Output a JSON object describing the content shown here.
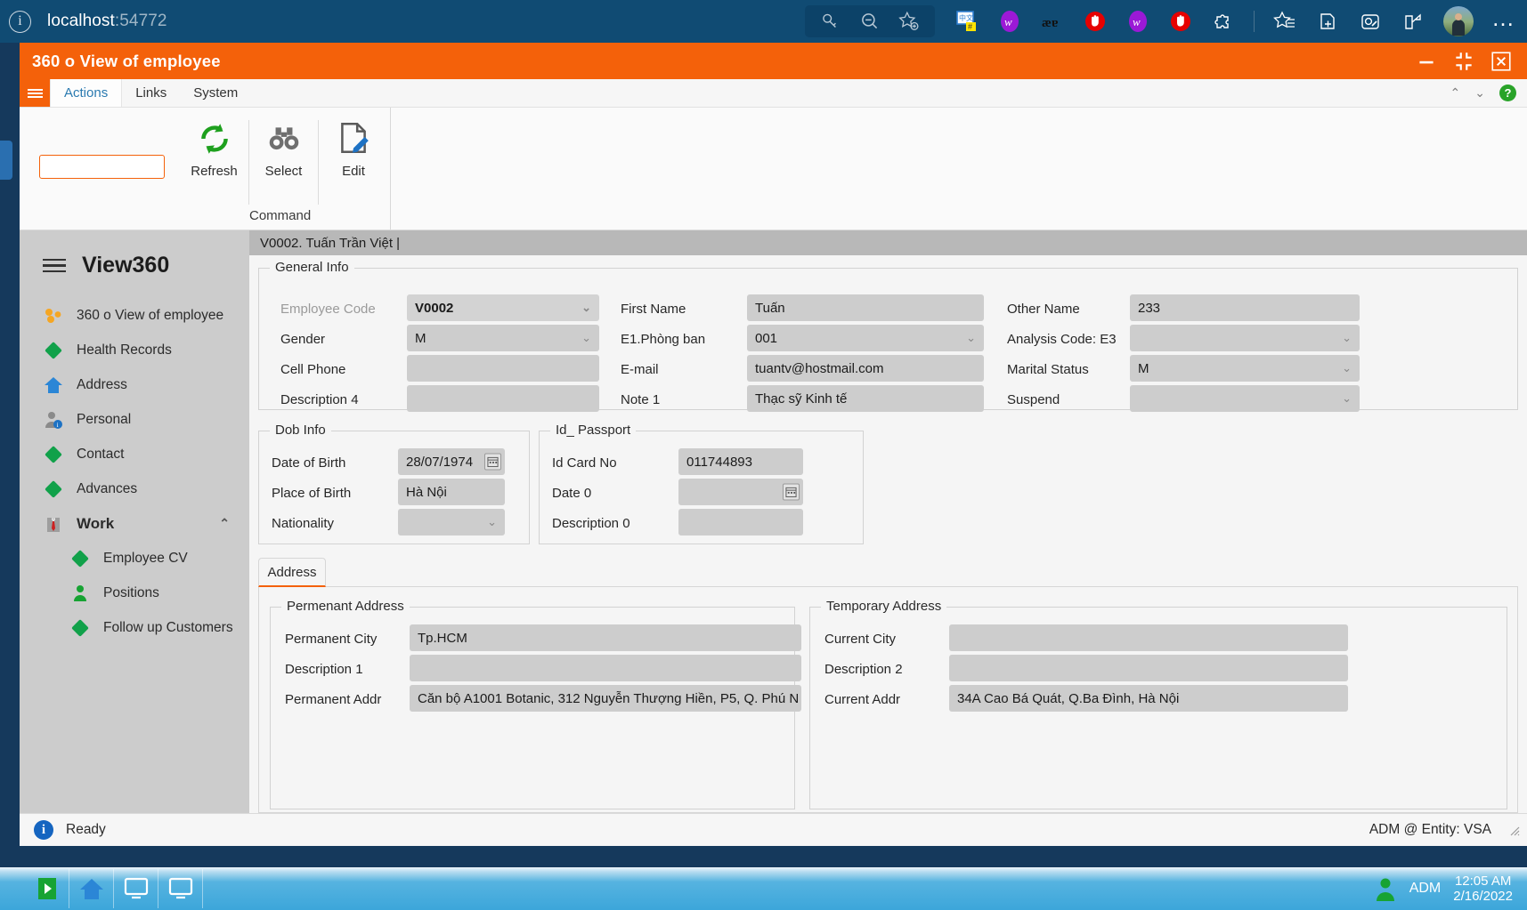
{
  "browser": {
    "info_icon": "info-circle-icon",
    "url_host": "localhost",
    "url_port": ":54772",
    "pill_icons": [
      "password-key-icon",
      "zoom-out-icon",
      "add-favorite-icon"
    ],
    "extension_icons": [
      "translate-extension-icon",
      "wordtune-extension-icon",
      "ae-dictionary-extension-icon",
      "adblock-stop-extension-icon",
      "wordtune-extension-icon-2"
    ],
    "right_icons": [
      "wordtune-extension-icon-3",
      "adblock-stop-extension-icon-2",
      "extensions-puzzle-icon",
      "favorites-star-icon",
      "collections-icon",
      "screenshot-capture-icon",
      "share-icon"
    ],
    "avatar": "profile-avatar",
    "more": "…"
  },
  "app": {
    "title": "360 o View of employee",
    "window_buttons": [
      "minimize-button",
      "restore-button",
      "close-button"
    ]
  },
  "ribbon": {
    "tabs": [
      {
        "label": "Actions",
        "active": true
      },
      {
        "label": "Links",
        "active": false
      },
      {
        "label": "System",
        "active": false
      }
    ],
    "collapse_up": "⌃",
    "collapse_down": "⌄",
    "help": "?",
    "search_value": "",
    "search_placeholder": "",
    "buttons": [
      {
        "label": "Refresh",
        "icon": "refresh-icon"
      },
      {
        "label": "Select",
        "icon": "binoculars-icon"
      },
      {
        "label": "Edit",
        "icon": "edit-pencil-icon"
      }
    ],
    "group_label": "Command"
  },
  "sidebar": {
    "brand": "View360",
    "menu_icon": "hamburger-menu-icon",
    "items": [
      {
        "label": "360 o View of employee",
        "icon": "orange-cluster-icon",
        "level": "top"
      },
      {
        "label": "Health Records",
        "icon": "green-diamond-icon",
        "level": "top"
      },
      {
        "label": "Address",
        "icon": "blue-home-icon",
        "level": "top"
      },
      {
        "label": "Personal",
        "icon": "person-info-icon",
        "level": "top"
      },
      {
        "label": "Contact",
        "icon": "green-diamond-icon",
        "level": "top"
      },
      {
        "label": "Advances",
        "icon": "green-diamond-icon",
        "level": "top"
      },
      {
        "label": "Work",
        "icon": "shirt-tie-icon",
        "level": "group",
        "expanded": true,
        "chevron": "⌃"
      },
      {
        "label": "Employee CV",
        "icon": "green-diamond-icon",
        "level": "sub"
      },
      {
        "label": "Positions",
        "icon": "green-person-icon",
        "level": "sub"
      },
      {
        "label": "Follow up Customers",
        "icon": "green-diamond-icon",
        "level": "sub"
      }
    ]
  },
  "record": {
    "tab_label": "V0002. Tuấn Trần Việt |"
  },
  "general_info": {
    "legend": "General Info",
    "fields": {
      "employee_code": {
        "label": "Employee Code",
        "value": "V0002",
        "type": "select",
        "disabled": true
      },
      "first_name": {
        "label": "First Name",
        "value": "Tuấn",
        "type": "text"
      },
      "other_name": {
        "label": "Other Name",
        "value": "233",
        "type": "text"
      },
      "gender": {
        "label": "Gender",
        "value": "M",
        "type": "select"
      },
      "department": {
        "label": "E1.Phòng ban",
        "value": "001",
        "type": "select"
      },
      "analysis_code": {
        "label": "Analysis Code: E3",
        "value": "",
        "type": "select"
      },
      "cell_phone": {
        "label": "Cell Phone",
        "value": "",
        "type": "text"
      },
      "email": {
        "label": "E-mail",
        "value": "tuantv@hostmail.com",
        "type": "text"
      },
      "marital_status": {
        "label": "Marital Status",
        "value": "M",
        "type": "select"
      },
      "description_4": {
        "label": "Description 4",
        "value": "",
        "type": "text"
      },
      "note_1": {
        "label": "Note 1",
        "value": "Thạc sỹ Kinh tế",
        "type": "text"
      },
      "suspend": {
        "label": "Suspend",
        "value": "",
        "type": "select"
      }
    }
  },
  "dob_info": {
    "legend": "Dob Info",
    "fields": {
      "date_of_birth": {
        "label": "Date of Birth",
        "value": "28/07/1974",
        "type": "date"
      },
      "place_of_birth": {
        "label": "Place of Birth",
        "value": "Hà Nội",
        "type": "text"
      },
      "nationality": {
        "label": "Nationality",
        "value": "",
        "type": "select"
      }
    }
  },
  "id_passport": {
    "legend": "Id_ Passport",
    "fields": {
      "id_card_no": {
        "label": "Id Card No",
        "value": "011744893",
        "type": "text"
      },
      "date_0": {
        "label": "Date 0",
        "value": "",
        "type": "date"
      },
      "description_0": {
        "label": "Description 0",
        "value": "",
        "type": "text"
      }
    }
  },
  "address_section": {
    "tab_label": "Address",
    "permanent": {
      "legend": "Permenant Address",
      "fields": {
        "permanent_city": {
          "label": "Permanent City",
          "value": "Tp.HCM",
          "type": "text"
        },
        "description_1": {
          "label": "Description 1",
          "value": "",
          "type": "text"
        },
        "permanent_addr": {
          "label": "Permanent Addr",
          "value": "Căn bộ A1001 Botanic, 312 Nguyễn Thượng Hiền, P5, Q. Phú N",
          "type": "text"
        }
      }
    },
    "temporary": {
      "legend": "Temporary Address",
      "fields": {
        "current_city": {
          "label": "Current City",
          "value": "",
          "type": "text"
        },
        "description_2": {
          "label": "Description 2",
          "value": "",
          "type": "text"
        },
        "current_addr": {
          "label": "Current Addr",
          "value": "34A Cao Bá Quát, Q.Ba Đình, Hà Nội",
          "type": "text"
        }
      }
    }
  },
  "status_bar": {
    "icon": "info-status-icon",
    "text": "Ready",
    "right_text": "ADM @ Entity: VSA",
    "grip": "resize-grip-icon"
  },
  "taskbar": {
    "buttons": [
      "start-play-icon",
      "home-icon",
      "monitor-icon",
      "monitor-icon-2"
    ],
    "user_icon": "user-person-icon",
    "user": "ADM",
    "time": "12:05 AM",
    "date": "2/16/2022"
  },
  "colors": {
    "accent_orange": "#f4610a",
    "browser_blue": "#104b73",
    "rail_navy": "#15395c",
    "sidebar_gray": "#cccccc",
    "field_gray": "#cdcdcd",
    "green": "#11a14a"
  }
}
